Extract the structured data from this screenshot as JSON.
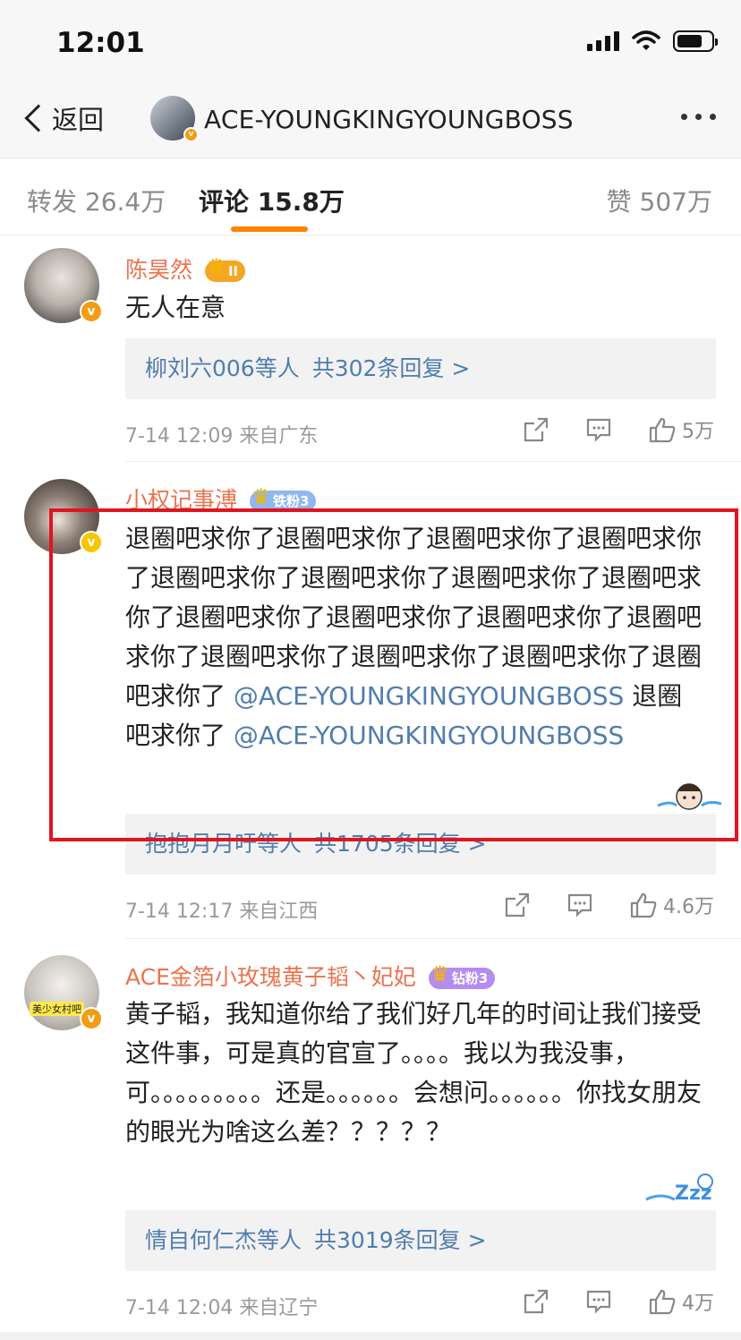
{
  "status_bar": {
    "time": "12:01"
  },
  "nav": {
    "back_label": "返回",
    "title": "ACE-YOUNGKINGYOUNGBOSS",
    "verified_mark": "v"
  },
  "tabs": [
    {
      "label": "转发 26.4万"
    },
    {
      "label": "评论 15.8万"
    },
    {
      "label": "赞 507万"
    }
  ],
  "colors": {
    "accent": "#ff8200",
    "username": "#eb7350",
    "link": "#507daf",
    "highlight_border": "#e0151f"
  },
  "comments": [
    {
      "username": "陈昊然",
      "badge": "II",
      "badge_color": "#f5a623",
      "verified_mark": "v",
      "text": "无人在意",
      "reply_names": "柳刘六006等人",
      "reply_count": "共302条回复 >",
      "time_location": "7-14 12:09  来自广东",
      "likes": "5万"
    },
    {
      "username": "小权记事溥",
      "badge": "铁粉3",
      "badge_color": "#8fb7f0",
      "verified_mark": "v",
      "text_parts": [
        "退圈吧求你了退圈吧求你了退圈吧求你了退圈吧求你了退圈吧求你了退圈吧求你了退圈吧求你了退圈吧求你了退圈吧求你了退圈吧求你了退圈吧求你了退圈吧求你了退圈吧求你了退圈吧求你了退圈吧求你了退圈吧求你了",
        "@ACE-YOUNGKINGYOUNGBOSS",
        "退圈吧求你了",
        "@ACE-YOUNGKINGYOUNGBOSS"
      ],
      "reply_names": "抱抱月月吁等人",
      "reply_count": "共1705条回复 >",
      "time_location": "7-14 12:17  来自江西",
      "likes": "4.6万"
    },
    {
      "username": "ACE金箔小玫瑰黄子韬丶妃妃",
      "badge": "钻粉3",
      "badge_color": "#b68cf0",
      "verified_mark": "v",
      "avatar_caption": "美少女村吧",
      "text": "黄子韬，我知道你给了我们好几年的时间让我们接受这件事，可是真的官宣了。。。。我以为我没事，可。。。。。。。。。还是。。。。。。会想问。。。。。。你找女朋友的眼光为啥这么差？？？？？",
      "reply_names": "情自何仁杰等人",
      "reply_count": "共3019条回复 >",
      "time_location": "7-14 12:04  来自辽宁",
      "likes": "4万"
    }
  ]
}
